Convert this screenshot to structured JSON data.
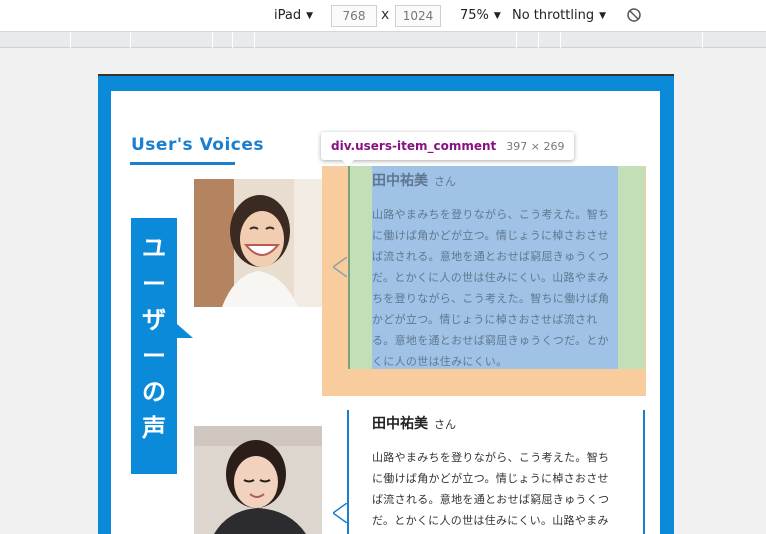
{
  "toolbar": {
    "device": "iPad",
    "width": "768",
    "times": "x",
    "height": "1024",
    "zoom": "75%",
    "throttling": "No throttling",
    "caret": "▼"
  },
  "page": {
    "section_title": "User's Voices",
    "vertical_label": [
      "ユ",
      "ー",
      "ザ",
      "ー",
      "の",
      "声"
    ]
  },
  "tooltip": {
    "selector": "div.users-item_comment",
    "size": "397 × 269"
  },
  "comments": [
    {
      "name": "田中祐美",
      "suffix": "さん",
      "body": "山路やまみちを登りながら、こう考えた。智ちに働けば角かどが立つ。情じょうに棹さおさせば流される。意地を通とおせば窮屈きゅうくつだ。とかくに人の世は住みにくい。山路やまみちを登りながら、こう考えた。智ちに働けば角かどが立つ。情じょうに棹さおさせば流される。意地を通とおせば窮屈きゅうくつだ。とかくに人の世は住みにくい。"
    },
    {
      "name": "田中祐美",
      "suffix": "さん",
      "body": "山路やまみちを登りながら、こう考えた。智ちに働けば角かどが立つ。情じょうに棹さおさせば流される。意地を通とおせば窮屈きゅうくつだ。とかくに人の世は住みにくい。山路やまみ"
    }
  ],
  "colors": {
    "accent": "#0a8ad8",
    "title_blue": "#1a7fd0",
    "highlight_margin": "#f9cc9d",
    "highlight_padding": "#c3dfb7",
    "highlight_content": "#9fc2e6"
  },
  "icons": {
    "rotate": "rotate-icon",
    "notch": "speech-notch-icon"
  }
}
